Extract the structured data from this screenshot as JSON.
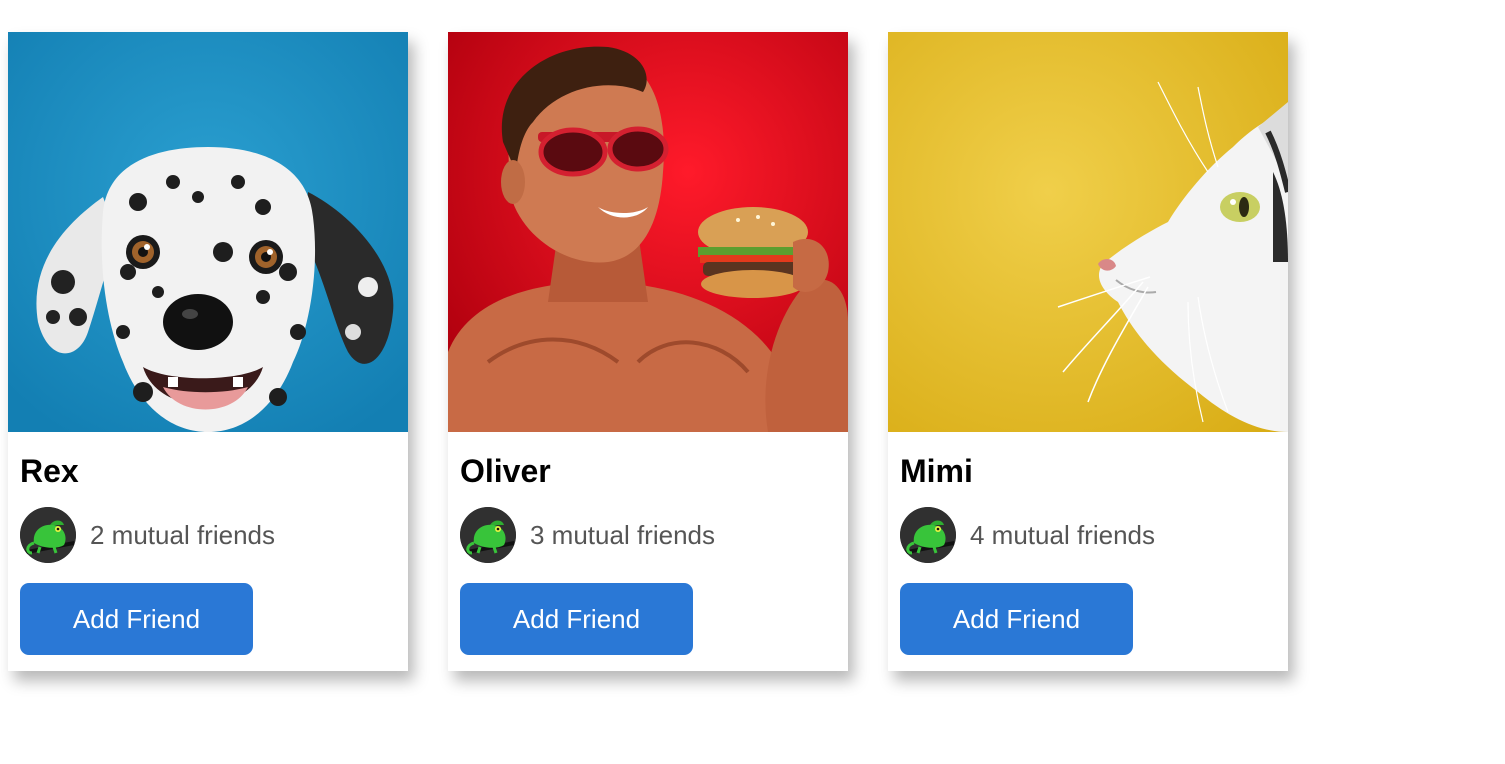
{
  "cards": [
    {
      "name": "Rex",
      "photo": "dalmatian-dog-photo",
      "photo_bg": "#1a8cbf",
      "mutual_text": "2 mutual friends",
      "avatar": "green-chameleon-avatar",
      "button_label": "Add Friend"
    },
    {
      "name": "Oliver",
      "photo": "man-with-sunglasses-and-burger-photo",
      "photo_bg": "#e0101f",
      "mutual_text": "3 mutual friends",
      "avatar": "green-chameleon-avatar",
      "button_label": "Add Friend"
    },
    {
      "name": "Mimi",
      "photo": "white-cat-profile-photo",
      "photo_bg": "#e8bf2c",
      "mutual_text": "4 mutual friends",
      "avatar": "green-chameleon-avatar",
      "button_label": "Add Friend"
    }
  ],
  "colors": {
    "button": "#2a78d6",
    "button_text": "#ffffff",
    "mutual_text": "#555555"
  }
}
